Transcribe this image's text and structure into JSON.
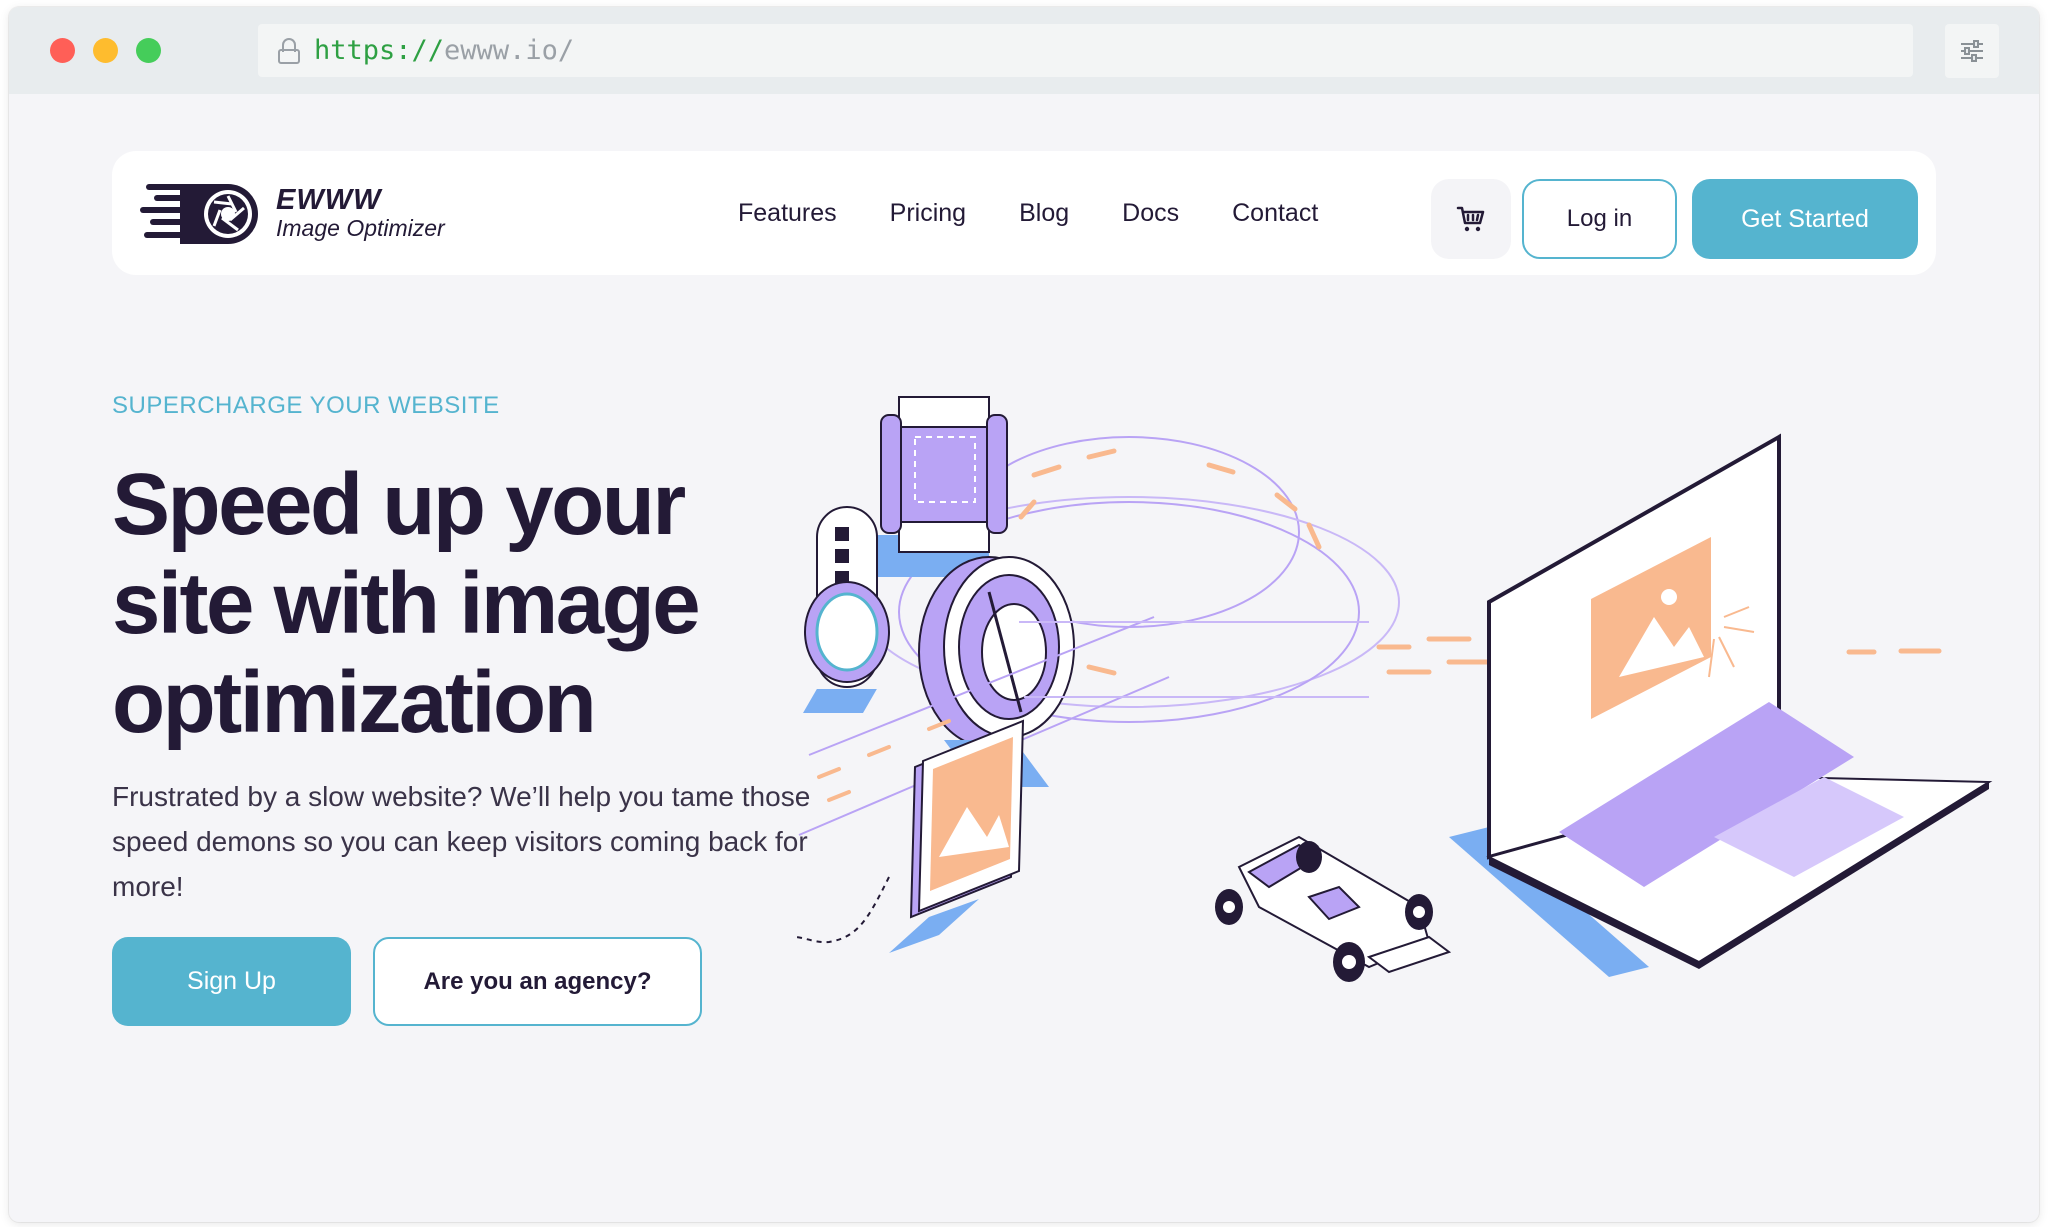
{
  "browser": {
    "url_scheme": "https://",
    "url_host": "ewww.io/"
  },
  "nav": {
    "logo_name": "EWWW",
    "logo_sub": "Image Optimizer",
    "links": [
      "Features",
      "Pricing",
      "Blog",
      "Docs",
      "Contact"
    ],
    "cart_icon": "cart-icon",
    "login_label": "Log in",
    "cta_label": "Get Started"
  },
  "hero": {
    "eyebrow": "SUPERCHARGE YOUR WEBSITE",
    "headline": "Speed up your site with image optimization",
    "lead": "Frustrated by a slow website? We’ll help you tame those speed demons so you can keep visitors coming back for more!",
    "primary_cta": "Sign Up",
    "secondary_cta": "Are you an agency?"
  },
  "colors": {
    "accent": "#55b4cf",
    "text_dark": "#231a36",
    "purple": "#b9a3f5",
    "peach": "#f9b98f",
    "blue": "#7aaef2"
  }
}
